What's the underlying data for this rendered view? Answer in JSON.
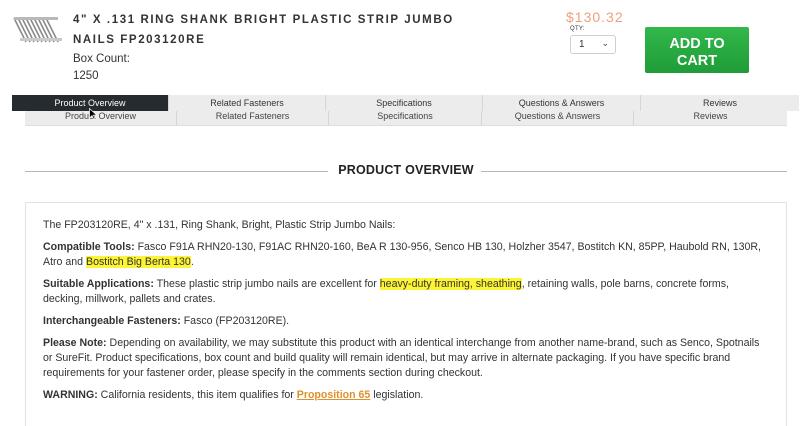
{
  "product": {
    "title_line1": "4\" X .131 RING SHANK BRIGHT PLASTIC STRIP JUMBO",
    "title_line2": "NAILS FP203120RE",
    "box_count_label": "Box Count:",
    "box_count_value": "1250",
    "price": "$130.32",
    "qty_label": "QTY:",
    "qty_value": "1",
    "add_to_cart_line1": "ADD TO",
    "add_to_cart_line2": "CART",
    "thumbnail_icon": "nail-strip-image"
  },
  "tabs": [
    {
      "label": "Product Overview",
      "active": true
    },
    {
      "label": "Related Fasteners",
      "active": false
    },
    {
      "label": "Specifications",
      "active": false
    },
    {
      "label": "Questions & Answers",
      "active": false
    },
    {
      "label": "Reviews",
      "active": false
    }
  ],
  "section": {
    "heading": "PRODUCT OVERVIEW"
  },
  "overview": {
    "intro": "The FP203120RE, 4\" x .131, Ring Shank, Bright, Plastic Strip Jumbo Nails:",
    "compatible_label": "Compatible Tools:",
    "compatible_text": " Fasco F91A RHN20-130, F91AC RHN20-160, BeA R 130-956, Senco HB 130, Holzher 3547, Bostitch KN, 85PP, Haubold RN, 130R, Atro and ",
    "compatible_highlight": "Bostitch Big Berta 130",
    "compatible_end": ".",
    "suitable_label": "Suitable Applications:",
    "suitable_text1": " These plastic strip jumbo nails are excellent for ",
    "suitable_highlight": "heavy-duty framing, sheathing",
    "suitable_text2": ", retaining walls, pole barns, concrete forms, decking, millwork, pallets and crates.",
    "interchangeable_label": "Interchangeable Fasteners:",
    "interchangeable_text": " Fasco (FP203120RE).",
    "note_label": "Please Note:",
    "note_text": " Depending on availability, we may substitute this product with an identical interchange from another name-brand, such as Senco, Spotnails or SureFit. Product specifications, box count and build quality will remain identical, but may arrive in alternate packaging. If you have specific brand requirements for your fastener order, please specify in the comments section during checkout.",
    "warning_label": "WARNING:",
    "warning_text": " California residents, this item qualifies for ",
    "warning_link": "Proposition 65",
    "warning_end": " legislation."
  },
  "colors": {
    "price": "#f0a07a",
    "add_to_cart": "#28ac40",
    "active_tab": "#262b2f",
    "highlight": "#fcf434",
    "link": "#e0902a"
  }
}
